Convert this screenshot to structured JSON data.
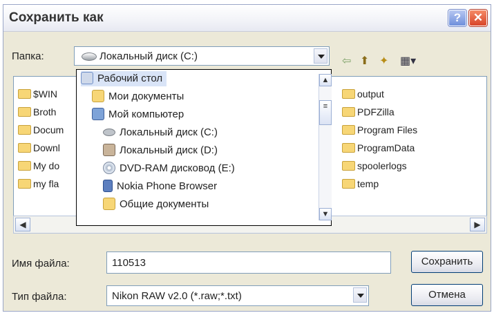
{
  "dialog": {
    "title": "Сохранить как",
    "help_icon": "?",
    "close_icon": "✕"
  },
  "toolbar": {
    "folder_label": "Папка:",
    "location_value": "Локальный диск (C:)",
    "back_icon": "⇦",
    "up_icon": "⬆",
    "new_folder_icon": "✦",
    "view_icon": "▦▾"
  },
  "files": {
    "left": [
      "$WIN",
      "Broth",
      "Docum",
      "Downl",
      "My do",
      "my fla"
    ],
    "right": [
      "output",
      "PDFZilla",
      "Program Files",
      "ProgramData",
      "spoolerlogs",
      "temp"
    ]
  },
  "location_dropdown": {
    "items": [
      {
        "label": "Рабочий стол",
        "icon": "desktop-icon"
      },
      {
        "label": "Мои документы",
        "icon": "folder-icon"
      },
      {
        "label": "Мой компьютер",
        "icon": "computer-icon"
      },
      {
        "label": "Локальный диск (C:)",
        "icon": "drive-icon"
      },
      {
        "label": "Локальный диск (D:)",
        "icon": "drive-icon"
      },
      {
        "label": "DVD-RAM дисковод (E:)",
        "icon": "dvd-icon"
      },
      {
        "label": "Nokia Phone Browser",
        "icon": "phone-icon"
      },
      {
        "label": "Общие документы",
        "icon": "folder-icon"
      }
    ]
  },
  "filename": {
    "label": "Имя файла:",
    "value": "110513"
  },
  "filetype": {
    "label": "Тип файла:",
    "value": "Nikon RAW v2.0 (*.raw;*.txt)"
  },
  "buttons": {
    "save": "Сохранить",
    "cancel": "Отмена"
  }
}
